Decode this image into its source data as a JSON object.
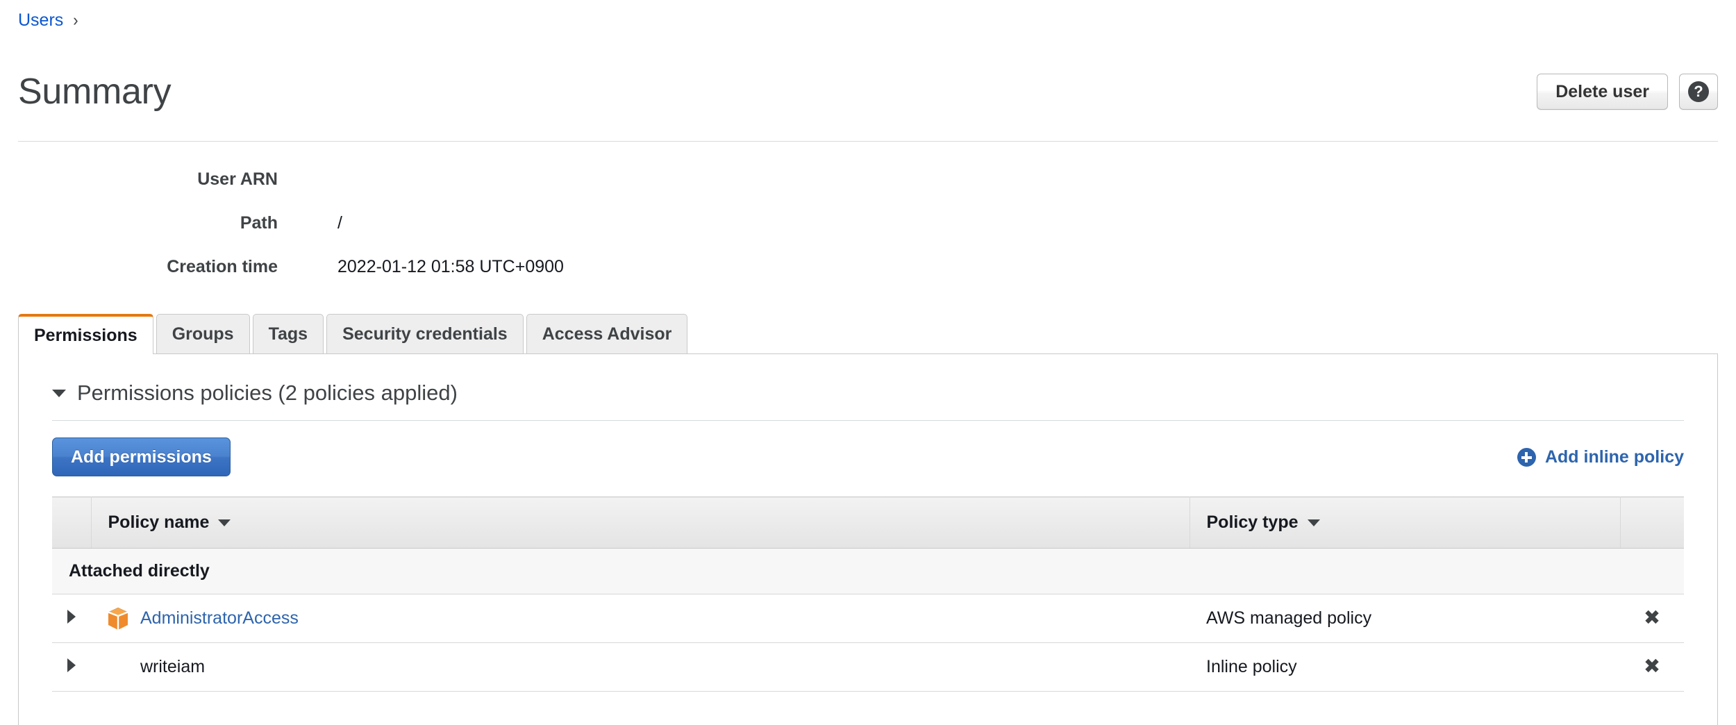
{
  "breadcrumb": {
    "root_label": "Users",
    "separator": "›",
    "current_label": ""
  },
  "header": {
    "title": "Summary",
    "delete_user_label": "Delete user",
    "help_label": "?"
  },
  "details": [
    {
      "label": "User ARN",
      "value": "",
      "has_copy": true,
      "copy_icon": "copy-icon"
    },
    {
      "label": "Path",
      "value": "/",
      "has_copy": false
    },
    {
      "label": "Creation time",
      "value": "2022-01-12 01:58 UTC+0900",
      "has_copy": false
    }
  ],
  "tabs": [
    {
      "label": "Permissions",
      "active": true
    },
    {
      "label": "Groups",
      "active": false
    },
    {
      "label": "Tags",
      "active": false
    },
    {
      "label": "Security credentials",
      "active": false
    },
    {
      "label": "Access Advisor",
      "active": false
    }
  ],
  "permissions_section": {
    "heading": "Permissions policies (2 policies applied)",
    "collapse_icon": "chevron-down-icon",
    "add_permissions_label": "Add permissions",
    "add_inline_policy_label": "Add inline policy",
    "add_inline_policy_icon": "plus-circle-icon"
  },
  "table": {
    "columns": [
      {
        "label": "Policy name",
        "sort_icon": "sort-caret-down-icon"
      },
      {
        "label": "Policy type",
        "sort_icon": "sort-caret-down-icon"
      }
    ],
    "groups": [
      {
        "group_label": "Attached directly",
        "rows": [
          {
            "expand_icon": "chevron-right-icon",
            "policy_icon": "aws-cube-icon",
            "policy_name": "AdministratorAccess",
            "is_link": true,
            "policy_type": "AWS managed policy",
            "remove_icon": "remove-x-icon",
            "remove_label": "✖"
          },
          {
            "expand_icon": "chevron-right-icon",
            "policy_icon": "",
            "policy_name": "writeiam",
            "is_link": false,
            "policy_type": "Inline policy",
            "remove_icon": "remove-x-icon",
            "remove_label": "✖"
          }
        ]
      }
    ]
  },
  "colors": {
    "link_blue": "#2d64ad",
    "breadcrumb_blue": "#0b57d0",
    "active_tab_accent": "#e47911",
    "primary_button_blue": "#3d74c4",
    "aws_cube_orange": "#ef8b2c",
    "text_dark": "#16191f",
    "border_grey": "#c9c9c9"
  }
}
